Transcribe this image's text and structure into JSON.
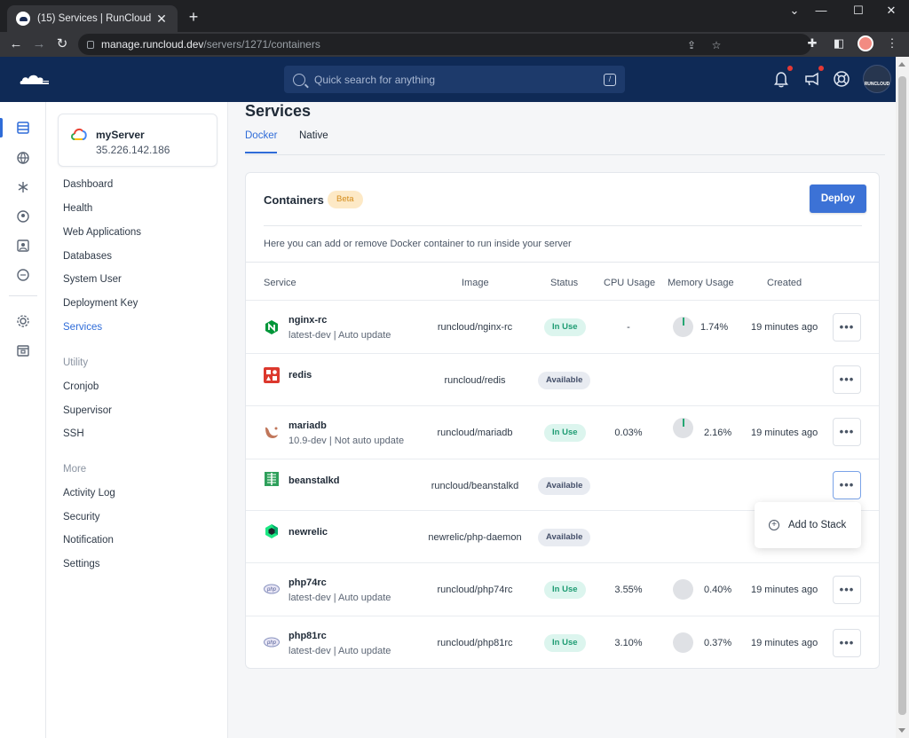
{
  "browser": {
    "tab_title": "(15) Services | RunCloud",
    "url_host": "manage.runcloud.dev",
    "url_path": "/servers/1271/containers"
  },
  "header": {
    "search_placeholder": "Quick search for anything",
    "search_shortcut": "/",
    "avatar_text": "RUNCLOUD"
  },
  "server": {
    "name": "myServer",
    "ip": "35.226.142.186"
  },
  "sidebar": {
    "items": [
      "Dashboard",
      "Health",
      "Web Applications",
      "Databases",
      "System User",
      "Deployment Key",
      "Services"
    ],
    "active": "Services",
    "utility_heading": "Utility",
    "utility": [
      "Cronjob",
      "Supervisor",
      "SSH"
    ],
    "more_heading": "More",
    "more": [
      "Activity Log",
      "Security",
      "Notification",
      "Settings"
    ]
  },
  "page": {
    "title": "Services",
    "tabs": [
      "Docker",
      "Native"
    ],
    "active_tab": "Docker"
  },
  "containers": {
    "title": "Containers",
    "badge": "Beta",
    "deploy_label": "Deploy",
    "description": "Here you can add or remove Docker container to run inside your server",
    "columns": [
      "Service",
      "Image",
      "Status",
      "CPU Usage",
      "Memory Usage",
      "Created"
    ],
    "rows": [
      {
        "name": "nginx-rc",
        "sub": "latest-dev | Auto update",
        "image": "runcloud/nginx-rc",
        "status": "In Use",
        "cpu": "-",
        "memory": "1.74%",
        "memory_fraction": 0.0174,
        "created": "19 minutes ago",
        "icon": "nginx-icon"
      },
      {
        "name": "redis",
        "sub": "",
        "image": "runcloud/redis",
        "status": "Available",
        "cpu": "",
        "memory": "",
        "created": "",
        "icon": "redis-icon"
      },
      {
        "name": "mariadb",
        "sub": "10.9-dev | Not auto update",
        "image": "runcloud/mariadb",
        "status": "In Use",
        "cpu": "0.03%",
        "memory": "2.16%",
        "memory_fraction": 0.0216,
        "created": "19 minutes ago",
        "icon": "mariadb-icon"
      },
      {
        "name": "beanstalkd",
        "sub": "",
        "image": "runcloud/beanstalkd",
        "status": "Available",
        "cpu": "",
        "memory": "",
        "created": "",
        "icon": "beanstalkd-icon"
      },
      {
        "name": "newrelic",
        "sub": "",
        "image": "newrelic/php-daemon",
        "status": "Available",
        "cpu": "",
        "memory": "",
        "created": "",
        "icon": "newrelic-icon"
      },
      {
        "name": "php74rc",
        "sub": "latest-dev | Auto update",
        "image": "runcloud/php74rc",
        "status": "In Use",
        "cpu": "3.55%",
        "memory": "0.40%",
        "memory_fraction": 0.004,
        "created": "19 minutes ago",
        "icon": "php-icon"
      },
      {
        "name": "php81rc",
        "sub": "latest-dev | Auto update",
        "image": "runcloud/php81rc",
        "status": "In Use",
        "cpu": "3.10%",
        "memory": "0.37%",
        "memory_fraction": 0.0037,
        "created": "19 minutes ago",
        "icon": "php-icon"
      }
    ],
    "more_label": "•••"
  },
  "popover": {
    "label": "Add to Stack"
  },
  "colors": {
    "accent": "#2f6cd8",
    "header_bg": "#0f2a56",
    "in_use": "#1f9c73",
    "beta": "#d38b19"
  }
}
